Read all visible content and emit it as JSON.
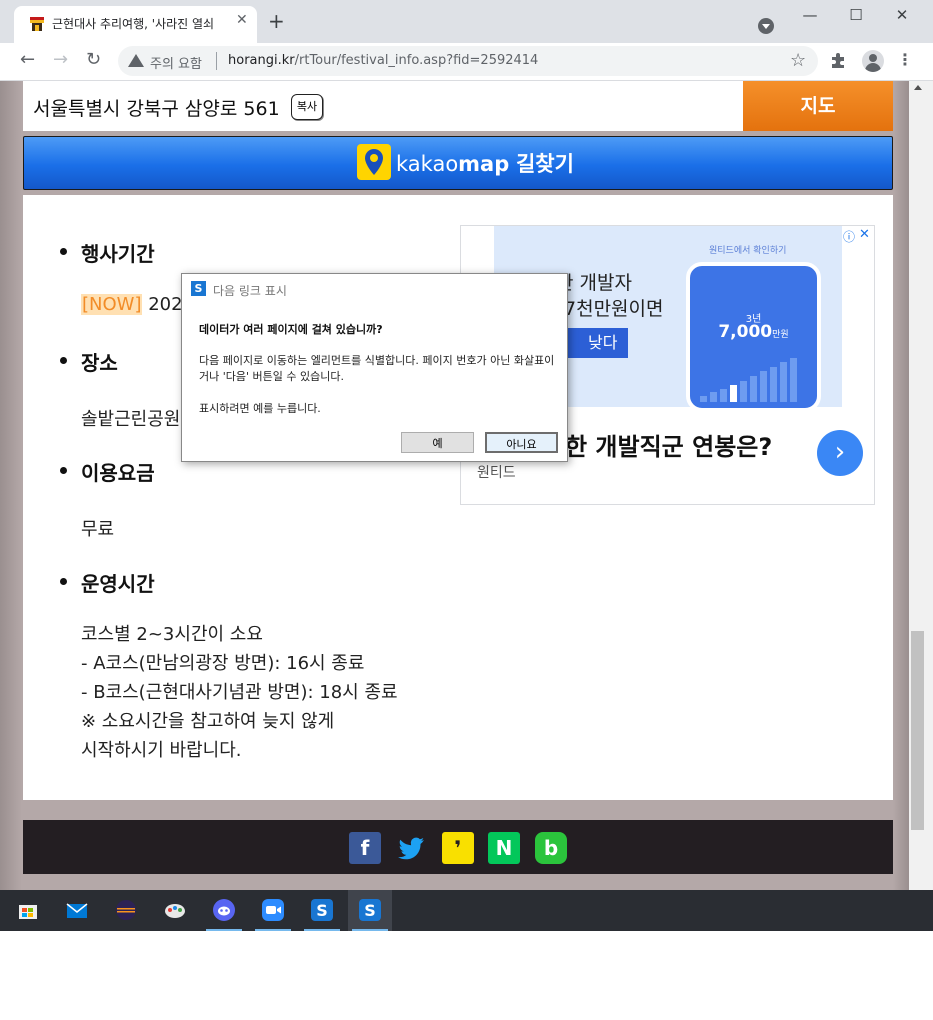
{
  "browser": {
    "tab_title": "근현대사 추리여행, '사라진 열쇠",
    "security_label": "주의 요함",
    "url_host": "horangi.kr",
    "url_path": "/rtTour/festival_info.asp?fid=2592414"
  },
  "address": {
    "text": "서울특별시 강북구 삼양로 561",
    "copy_label": "복사",
    "map_label": "지도"
  },
  "kakao": {
    "brand_light": "kakao",
    "brand_bold": "map",
    "route_label": "길찾기"
  },
  "sections": {
    "period": {
      "title": "행사기간",
      "badge": "[NOW]",
      "value": "202"
    },
    "place": {
      "title": "장소",
      "value": "솔밭근린공원"
    },
    "fee": {
      "title": "이용요금",
      "value": "무료"
    },
    "hours": {
      "title": "운영시간",
      "lines": [
        "코스별 2~3시간이 소요",
        "- A코스(만남의광장 방면): 16시 종료",
        "- B코스(근현대사기념관 방면): 18시 종료",
        "※ 소요시간을 참고하여 늦지 않게",
        "시작하시기 바랍니다."
      ]
    }
  },
  "ad": {
    "small_text": "원티드에서 확인하기",
    "line1": "이력한 개발자",
    "line2": "7천만원이면",
    "cta": "낮다",
    "phone_year": "3년",
    "phone_amount": "7,000",
    "phone_unit": "만원",
    "headline": "한 개발직군 연봉은?",
    "source": "원티드"
  },
  "dialog": {
    "title": "다음 링크 표시",
    "question": "데이터가 여러 페이지에 걸쳐 있습니까?",
    "description": "다음 페이지로 이동하는 엘리먼트를 식별합니다. 페이지 번호가 아닌 화살표이거나 '다음' 버튼일 수 있습니다.",
    "hint": "표시하려면 예를 누릅니다.",
    "yes_label": "예",
    "no_label": "아니요"
  },
  "share": [
    "facebook-icon",
    "twitter-icon",
    "kakaostory-icon",
    "naver-icon",
    "band-icon"
  ],
  "taskbar": [
    "store-icon",
    "mail-icon",
    "eclipse-icon",
    "paint-icon",
    "discord-icon",
    "zoom-icon",
    "scraper-app-icon",
    "scraper-app-icon-active"
  ],
  "colors": {
    "map_orange": "#f08320",
    "kakao_blue": "#1a6fe8",
    "now_orange": "#f28c28"
  }
}
